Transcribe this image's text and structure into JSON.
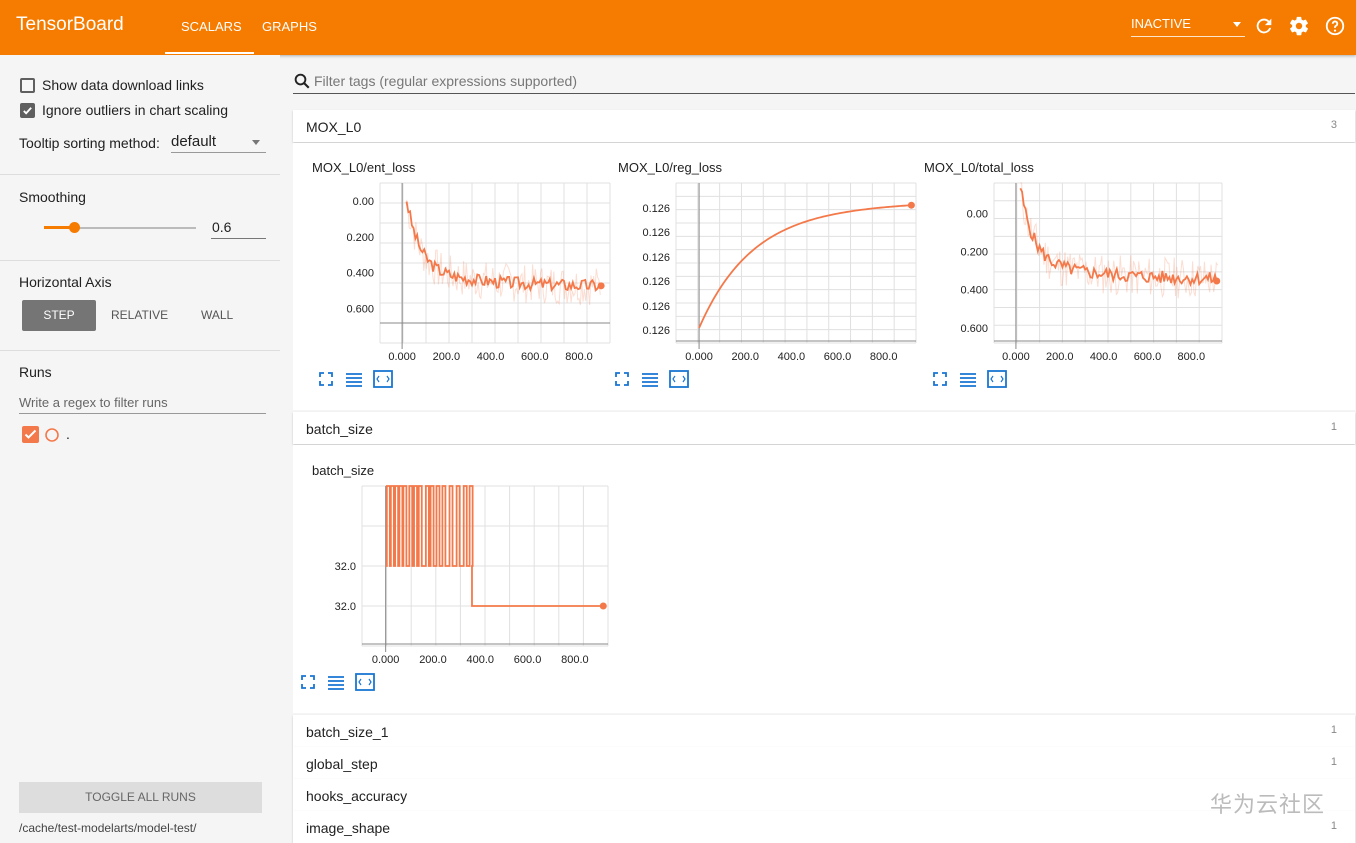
{
  "header": {
    "brand": "TensorBoard",
    "tabs": [
      {
        "label": "SCALARS",
        "active": true
      },
      {
        "label": "GRAPHS",
        "active": false
      }
    ],
    "status": "INACTIVE",
    "accent": "#f57c00"
  },
  "sidebar": {
    "show_download": "Show data download links",
    "ignore_outliers": "Ignore outliers in chart scaling",
    "tooltip_label": "Tooltip sorting method:",
    "tooltip_value": "default",
    "smoothing_label": "Smoothing",
    "smoothing_value": "0.6",
    "smoothing_fraction": 0.6,
    "axis_label": "Horizontal Axis",
    "axis_options": [
      "STEP",
      "RELATIVE",
      "WALL"
    ],
    "runs_label": "Runs",
    "runs_placeholder": "Write a regex to filter runs",
    "run_name": ".",
    "toggle_all": "TOGGLE ALL RUNS",
    "logdir": "/cache/test-modelarts/model-test/"
  },
  "main": {
    "filter_placeholder": "Filter tags (regular expressions supported)",
    "categories": [
      {
        "name": "MOX_L0",
        "count": "3"
      },
      {
        "name": "batch_size",
        "count": "1"
      },
      {
        "name": "batch_size_1",
        "count": "1"
      },
      {
        "name": "global_step",
        "count": "1"
      },
      {
        "name": "hooks_accuracy",
        "count": ""
      },
      {
        "name": "image_shape",
        "count": "1"
      }
    ]
  },
  "chart_data": [
    {
      "type": "line",
      "title": "MOX_L0/ent_loss",
      "xticks": [
        "0.000",
        "200.0",
        "400.0",
        "600.0",
        "800.0"
      ],
      "yticks": [
        "0.00",
        "0.200",
        "0.400",
        "0.600"
      ],
      "xlim": [
        -100,
        940
      ],
      "ylim": [
        -0.08,
        0.7
      ]
    },
    {
      "type": "line",
      "title": "MOX_L0/reg_loss",
      "xticks": [
        "0.000",
        "200.0",
        "400.0",
        "600.0",
        "800.0"
      ],
      "yticks": [
        "0.126",
        "0.126",
        "0.126",
        "0.126",
        "0.126",
        "0.126"
      ],
      "xlim": [
        -100,
        940
      ]
    },
    {
      "type": "line",
      "title": "MOX_L0/total_loss",
      "xticks": [
        "0.000",
        "200.0",
        "400.0",
        "600.0",
        "800.0"
      ],
      "yticks": [
        "0.00",
        "0.200",
        "0.400",
        "0.600"
      ],
      "xlim": [
        -100,
        940
      ],
      "ylim": [
        -0.08,
        0.76
      ]
    },
    {
      "type": "line",
      "title": "batch_size",
      "xticks": [
        "0.000",
        "200.0",
        "400.0",
        "600.0",
        "800.0"
      ],
      "yticks": [
        "32.0",
        "32.0"
      ],
      "xlim": [
        -100,
        940
      ]
    }
  ],
  "watermark": "华为云社区"
}
